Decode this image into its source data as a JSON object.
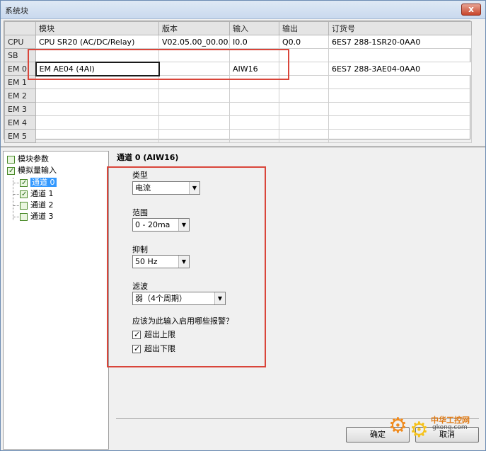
{
  "window": {
    "title": "系统块",
    "close_label": "x"
  },
  "grid": {
    "columns": [
      "",
      "模块",
      "版本",
      "输入",
      "输出",
      "订货号"
    ],
    "rows": [
      {
        "head": "CPU",
        "module": "CPU SR20 (AC/DC/Relay)",
        "version": "V02.05.00_00.00...",
        "input": "I0.0",
        "output": "Q0.0",
        "order": "6ES7 288-1SR20-0AA0"
      },
      {
        "head": "SB",
        "module": "",
        "version": "",
        "input": "",
        "output": "",
        "order": ""
      },
      {
        "head": "EM 0",
        "module": "EM AE04 (4AI)",
        "version": "",
        "input": "AIW16",
        "output": "",
        "order": "6ES7 288-3AE04-0AA0"
      },
      {
        "head": "EM 1",
        "module": "",
        "version": "",
        "input": "",
        "output": "",
        "order": ""
      },
      {
        "head": "EM 2",
        "module": "",
        "version": "",
        "input": "",
        "output": "",
        "order": ""
      },
      {
        "head": "EM 3",
        "module": "",
        "version": "",
        "input": "",
        "output": "",
        "order": ""
      },
      {
        "head": "EM 4",
        "module": "",
        "version": "",
        "input": "",
        "output": "",
        "order": ""
      },
      {
        "head": "EM 5",
        "module": "",
        "version": "",
        "input": "",
        "output": "",
        "order": ""
      }
    ]
  },
  "tree": {
    "items": [
      {
        "label": "模块参数",
        "checked": false
      },
      {
        "label": "模拟量输入",
        "checked": true
      },
      {
        "label": "通道 0",
        "checked": true,
        "selected": true
      },
      {
        "label": "通道 1",
        "checked": true
      },
      {
        "label": "通道 2",
        "checked": false
      },
      {
        "label": "通道 3",
        "checked": false
      }
    ]
  },
  "panel": {
    "title": "通道 0 (AIW16)",
    "type_label": "类型",
    "type_value": "电流",
    "range_label": "范围",
    "range_value": "0 - 20ma",
    "suppress_label": "抑制",
    "suppress_value": "50 Hz",
    "filter_label": "滤波",
    "filter_value": "弱（4个周期）",
    "alarm_question": "应该为此输入启用哪些报警？",
    "alarm_upper": "超出上限",
    "alarm_lower": "超出下限"
  },
  "buttons": {
    "ok": "确定",
    "cancel": "取消"
  },
  "watermark": {
    "text": "中华工控网",
    "url": "gkong.com"
  },
  "colors": {
    "highlight_red": "#d9453a",
    "tree_selection": "#3399ff"
  }
}
